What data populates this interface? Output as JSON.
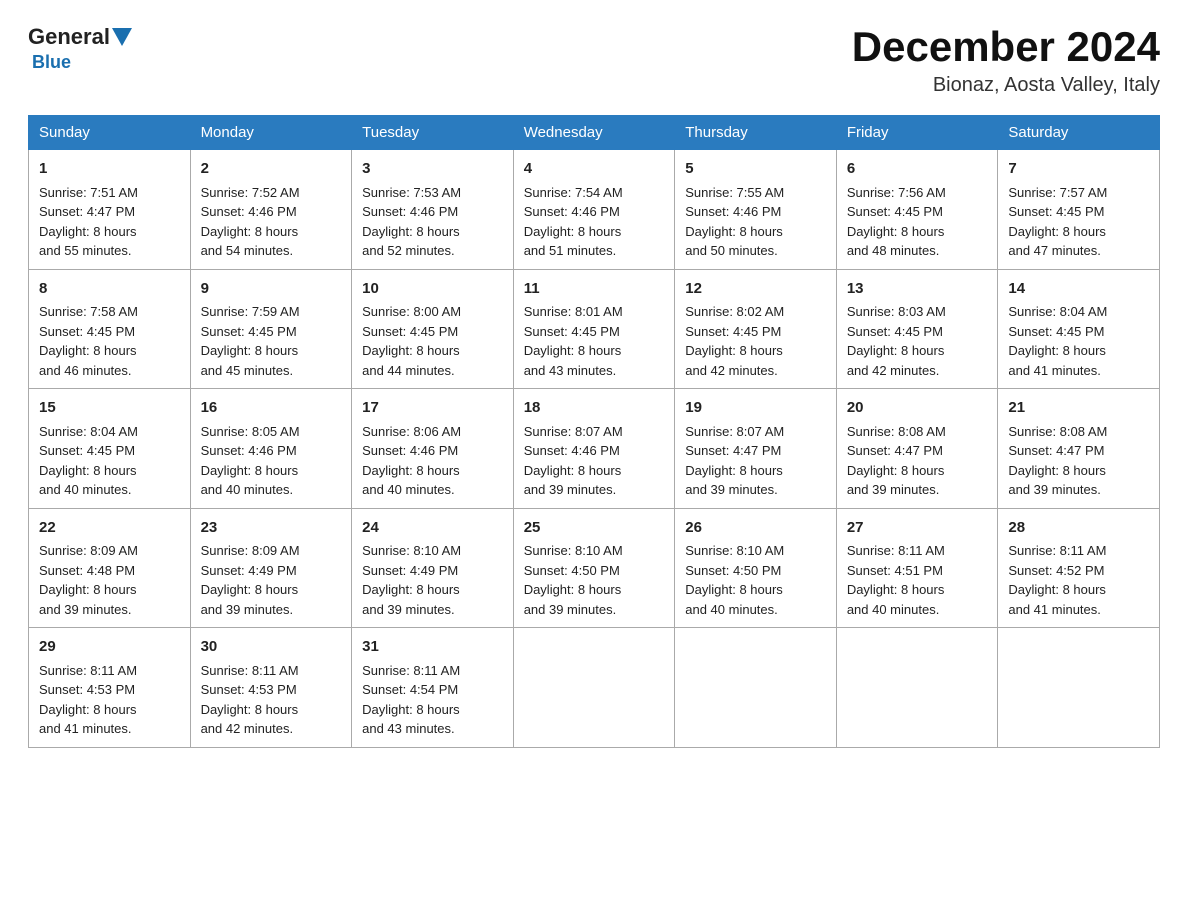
{
  "header": {
    "logo_general": "General",
    "logo_blue": "Blue",
    "month_year": "December 2024",
    "location": "Bionaz, Aosta Valley, Italy"
  },
  "weekdays": [
    "Sunday",
    "Monday",
    "Tuesday",
    "Wednesday",
    "Thursday",
    "Friday",
    "Saturday"
  ],
  "weeks": [
    [
      {
        "day": "1",
        "sunrise": "7:51 AM",
        "sunset": "4:47 PM",
        "daylight": "8 hours and 55 minutes."
      },
      {
        "day": "2",
        "sunrise": "7:52 AM",
        "sunset": "4:46 PM",
        "daylight": "8 hours and 54 minutes."
      },
      {
        "day": "3",
        "sunrise": "7:53 AM",
        "sunset": "4:46 PM",
        "daylight": "8 hours and 52 minutes."
      },
      {
        "day": "4",
        "sunrise": "7:54 AM",
        "sunset": "4:46 PM",
        "daylight": "8 hours and 51 minutes."
      },
      {
        "day": "5",
        "sunrise": "7:55 AM",
        "sunset": "4:46 PM",
        "daylight": "8 hours and 50 minutes."
      },
      {
        "day": "6",
        "sunrise": "7:56 AM",
        "sunset": "4:45 PM",
        "daylight": "8 hours and 48 minutes."
      },
      {
        "day": "7",
        "sunrise": "7:57 AM",
        "sunset": "4:45 PM",
        "daylight": "8 hours and 47 minutes."
      }
    ],
    [
      {
        "day": "8",
        "sunrise": "7:58 AM",
        "sunset": "4:45 PM",
        "daylight": "8 hours and 46 minutes."
      },
      {
        "day": "9",
        "sunrise": "7:59 AM",
        "sunset": "4:45 PM",
        "daylight": "8 hours and 45 minutes."
      },
      {
        "day": "10",
        "sunrise": "8:00 AM",
        "sunset": "4:45 PM",
        "daylight": "8 hours and 44 minutes."
      },
      {
        "day": "11",
        "sunrise": "8:01 AM",
        "sunset": "4:45 PM",
        "daylight": "8 hours and 43 minutes."
      },
      {
        "day": "12",
        "sunrise": "8:02 AM",
        "sunset": "4:45 PM",
        "daylight": "8 hours and 42 minutes."
      },
      {
        "day": "13",
        "sunrise": "8:03 AM",
        "sunset": "4:45 PM",
        "daylight": "8 hours and 42 minutes."
      },
      {
        "day": "14",
        "sunrise": "8:04 AM",
        "sunset": "4:45 PM",
        "daylight": "8 hours and 41 minutes."
      }
    ],
    [
      {
        "day": "15",
        "sunrise": "8:04 AM",
        "sunset": "4:45 PM",
        "daylight": "8 hours and 40 minutes."
      },
      {
        "day": "16",
        "sunrise": "8:05 AM",
        "sunset": "4:46 PM",
        "daylight": "8 hours and 40 minutes."
      },
      {
        "day": "17",
        "sunrise": "8:06 AM",
        "sunset": "4:46 PM",
        "daylight": "8 hours and 40 minutes."
      },
      {
        "day": "18",
        "sunrise": "8:07 AM",
        "sunset": "4:46 PM",
        "daylight": "8 hours and 39 minutes."
      },
      {
        "day": "19",
        "sunrise": "8:07 AM",
        "sunset": "4:47 PM",
        "daylight": "8 hours and 39 minutes."
      },
      {
        "day": "20",
        "sunrise": "8:08 AM",
        "sunset": "4:47 PM",
        "daylight": "8 hours and 39 minutes."
      },
      {
        "day": "21",
        "sunrise": "8:08 AM",
        "sunset": "4:47 PM",
        "daylight": "8 hours and 39 minutes."
      }
    ],
    [
      {
        "day": "22",
        "sunrise": "8:09 AM",
        "sunset": "4:48 PM",
        "daylight": "8 hours and 39 minutes."
      },
      {
        "day": "23",
        "sunrise": "8:09 AM",
        "sunset": "4:49 PM",
        "daylight": "8 hours and 39 minutes."
      },
      {
        "day": "24",
        "sunrise": "8:10 AM",
        "sunset": "4:49 PM",
        "daylight": "8 hours and 39 minutes."
      },
      {
        "day": "25",
        "sunrise": "8:10 AM",
        "sunset": "4:50 PM",
        "daylight": "8 hours and 39 minutes."
      },
      {
        "day": "26",
        "sunrise": "8:10 AM",
        "sunset": "4:50 PM",
        "daylight": "8 hours and 40 minutes."
      },
      {
        "day": "27",
        "sunrise": "8:11 AM",
        "sunset": "4:51 PM",
        "daylight": "8 hours and 40 minutes."
      },
      {
        "day": "28",
        "sunrise": "8:11 AM",
        "sunset": "4:52 PM",
        "daylight": "8 hours and 41 minutes."
      }
    ],
    [
      {
        "day": "29",
        "sunrise": "8:11 AM",
        "sunset": "4:53 PM",
        "daylight": "8 hours and 41 minutes."
      },
      {
        "day": "30",
        "sunrise": "8:11 AM",
        "sunset": "4:53 PM",
        "daylight": "8 hours and 42 minutes."
      },
      {
        "day": "31",
        "sunrise": "8:11 AM",
        "sunset": "4:54 PM",
        "daylight": "8 hours and 43 minutes."
      },
      null,
      null,
      null,
      null
    ]
  ]
}
